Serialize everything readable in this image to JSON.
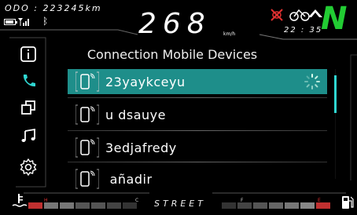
{
  "header": {
    "odometer": "ODO : 223245km",
    "speed": "268",
    "speed_unit": "km/h",
    "clock": "22 : 35",
    "gear": "N"
  },
  "sidebar": {
    "items": [
      {
        "icon": "info-icon"
      },
      {
        "icon": "phone-icon",
        "active": true
      },
      {
        "icon": "windows-icon"
      },
      {
        "icon": "music-note-icon"
      },
      {
        "icon": "gear-icon"
      }
    ]
  },
  "main": {
    "title": "Connection Mobile Devices",
    "devices": [
      {
        "name": "23yaykceyu",
        "selected": true,
        "status": "connecting"
      },
      {
        "name": "u dsauye"
      },
      {
        "name": "3edjafredy"
      },
      {
        "name": " añadir"
      }
    ]
  },
  "footer": {
    "mode": "STREET",
    "left_gauge_labels": [
      "H",
      "C"
    ],
    "right_gauge_labels": [
      "F",
      "E"
    ]
  },
  "colors": {
    "accent": "#1e8e8a",
    "gear": "#22cc33",
    "warning": "#e03030"
  }
}
